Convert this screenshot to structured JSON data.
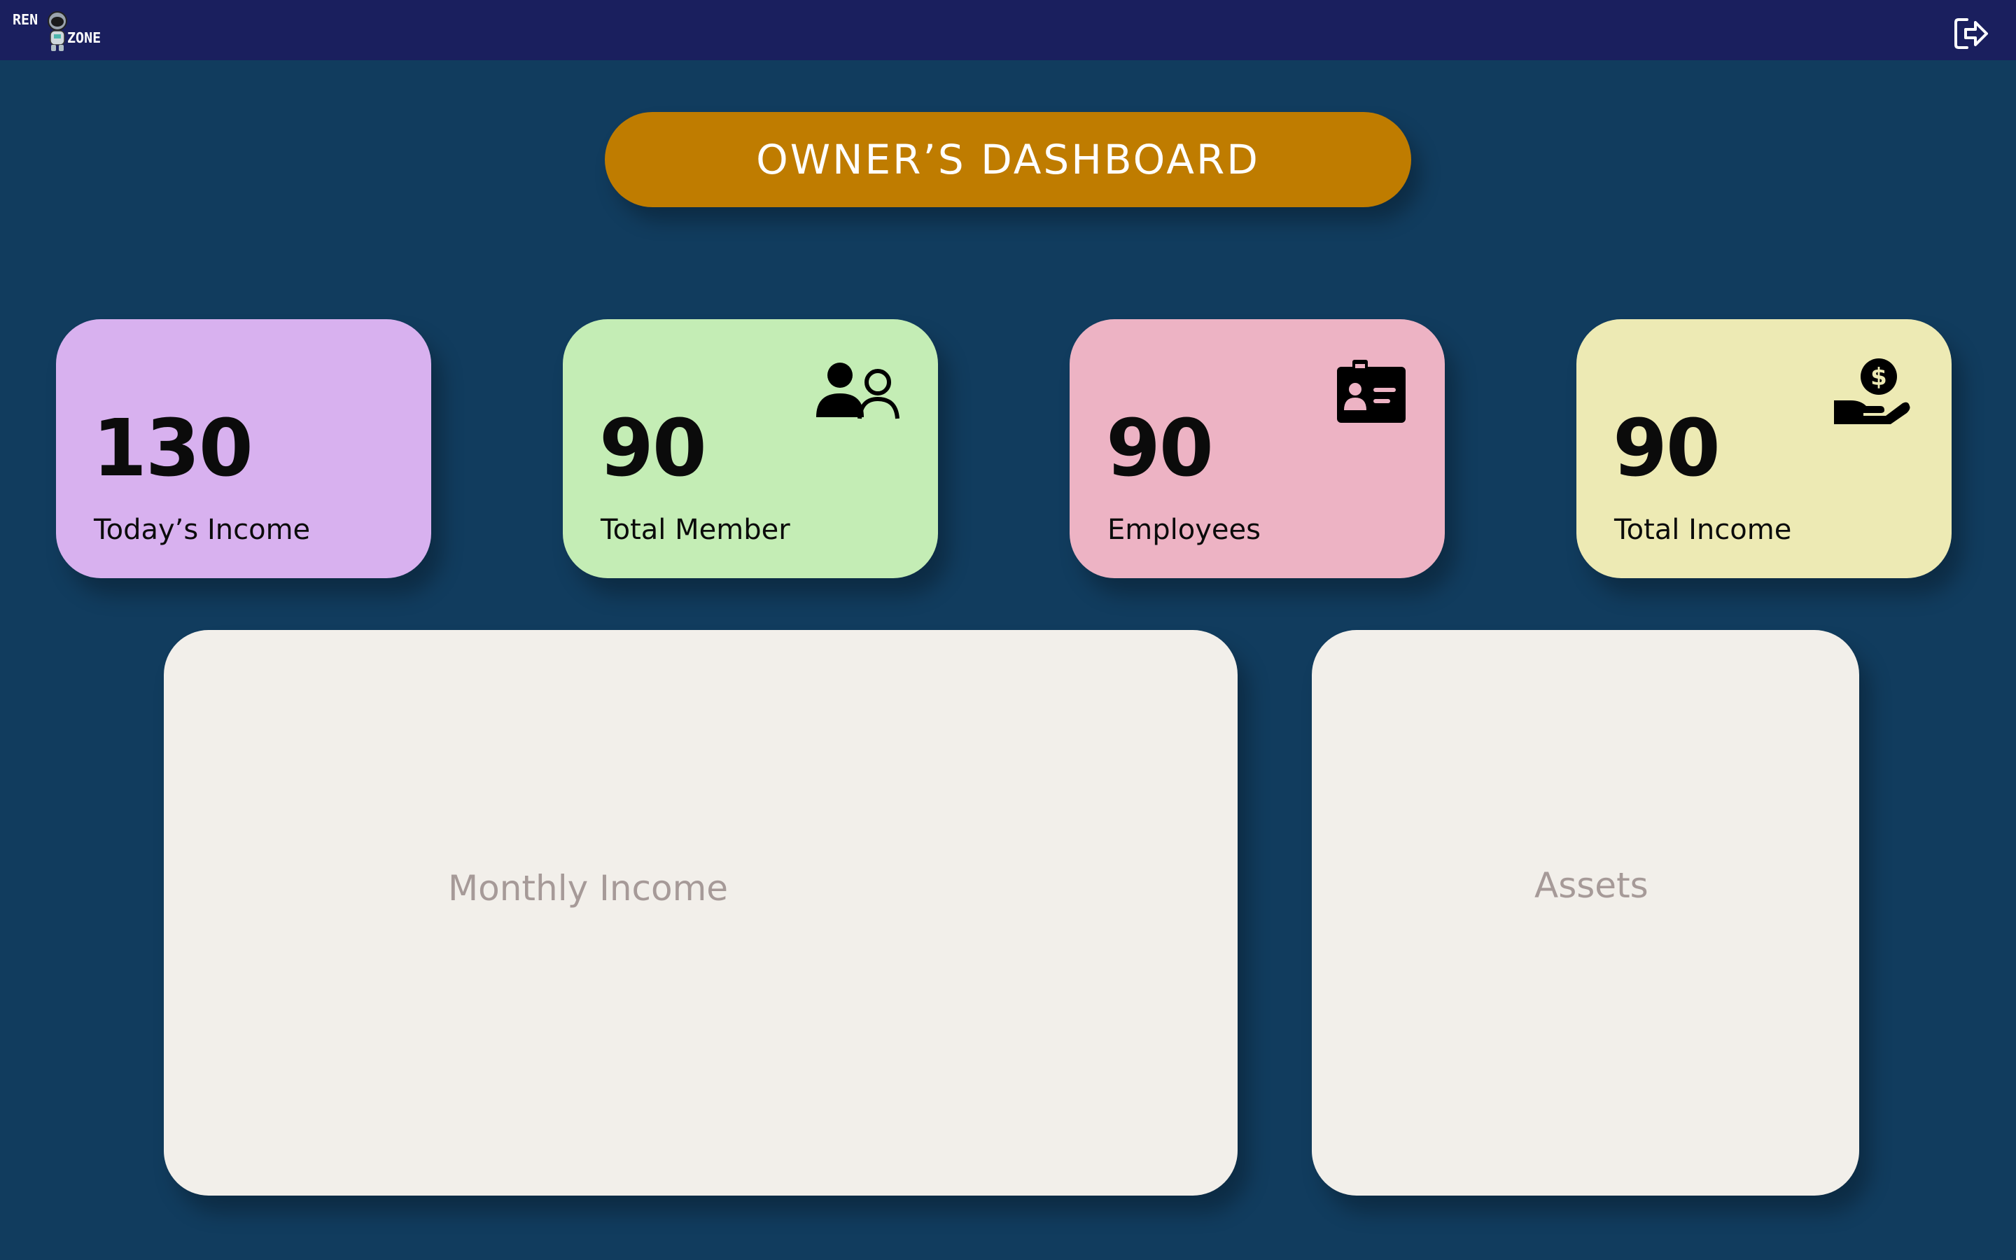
{
  "header": {
    "logo": {
      "word_top": "REN",
      "word_bottom": "ZONE"
    },
    "logout_icon": "logout-icon"
  },
  "dashboard": {
    "title": "OWNER’S DASHBOARD",
    "title_color": "#bf7c00"
  },
  "stats": [
    {
      "value": "130",
      "label": "Today’s Income",
      "color": "#d8b1ef",
      "icon": ""
    },
    {
      "value": "90",
      "label": "Total Member",
      "color": "#c4edb5",
      "icon": "users-icon"
    },
    {
      "value": "90",
      "label": "Employees",
      "color": "#edb3c4",
      "icon": "id-badge-icon"
    },
    {
      "value": "90",
      "label": "Total Income",
      "color": "#edeab4",
      "icon": "money-hand-icon"
    }
  ],
  "panels": {
    "monthly_income": {
      "title": "Monthly Income"
    },
    "assets": {
      "title": "Assets"
    }
  },
  "colors": {
    "background": "#113c5e",
    "topbar": "#1a1f5e",
    "panel": "#f2efea",
    "panel_title": "#a69a98"
  }
}
